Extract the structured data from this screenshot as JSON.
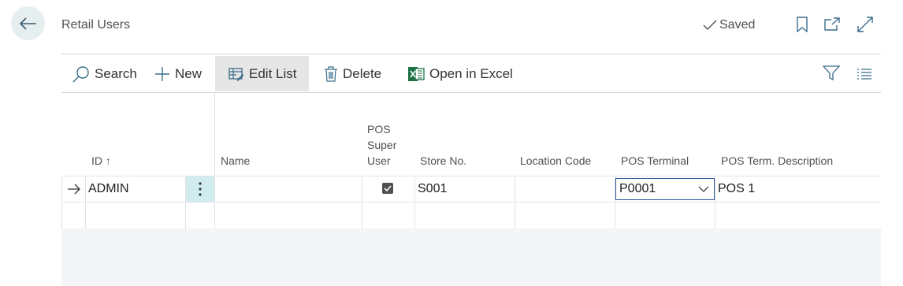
{
  "header": {
    "title": "Retail Users",
    "saved_label": "Saved"
  },
  "toolbar": {
    "search": "Search",
    "new": "New",
    "edit_list": "Edit List",
    "delete": "Delete",
    "open_in_excel": "Open in Excel"
  },
  "columns": {
    "id": "ID",
    "name": "Name",
    "pos_super_user": [
      "POS",
      "Super",
      "User"
    ],
    "store_no": "Store No.",
    "location_code": "Location Code",
    "pos_terminal": "POS Terminal",
    "pos_term_description": "POS Term. Description"
  },
  "rows": [
    {
      "id": "ADMIN",
      "name": "",
      "pos_super_user": true,
      "store_no": "S001",
      "location_code": "",
      "pos_terminal": "P0001",
      "pos_term_description": "POS 1"
    }
  ],
  "colors": {
    "accent": "#007e87",
    "excel_green": "#1e7145",
    "selected_cell_border": "#2b5797",
    "row_menu_bg": "#d0ecef"
  }
}
